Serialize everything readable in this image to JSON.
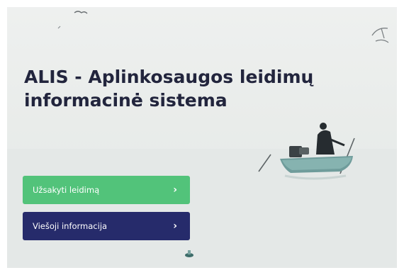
{
  "hero": {
    "title": "ALIS - Aplinkosaugos leidimų informacinė sistema"
  },
  "actions": [
    {
      "label": "Užsakyti leidimą",
      "icon": "chevron-right-icon",
      "color": "#52c37a"
    },
    {
      "label": "Viešoji informacija",
      "icon": "chevron-right-icon",
      "color": "#262b6b"
    }
  ]
}
